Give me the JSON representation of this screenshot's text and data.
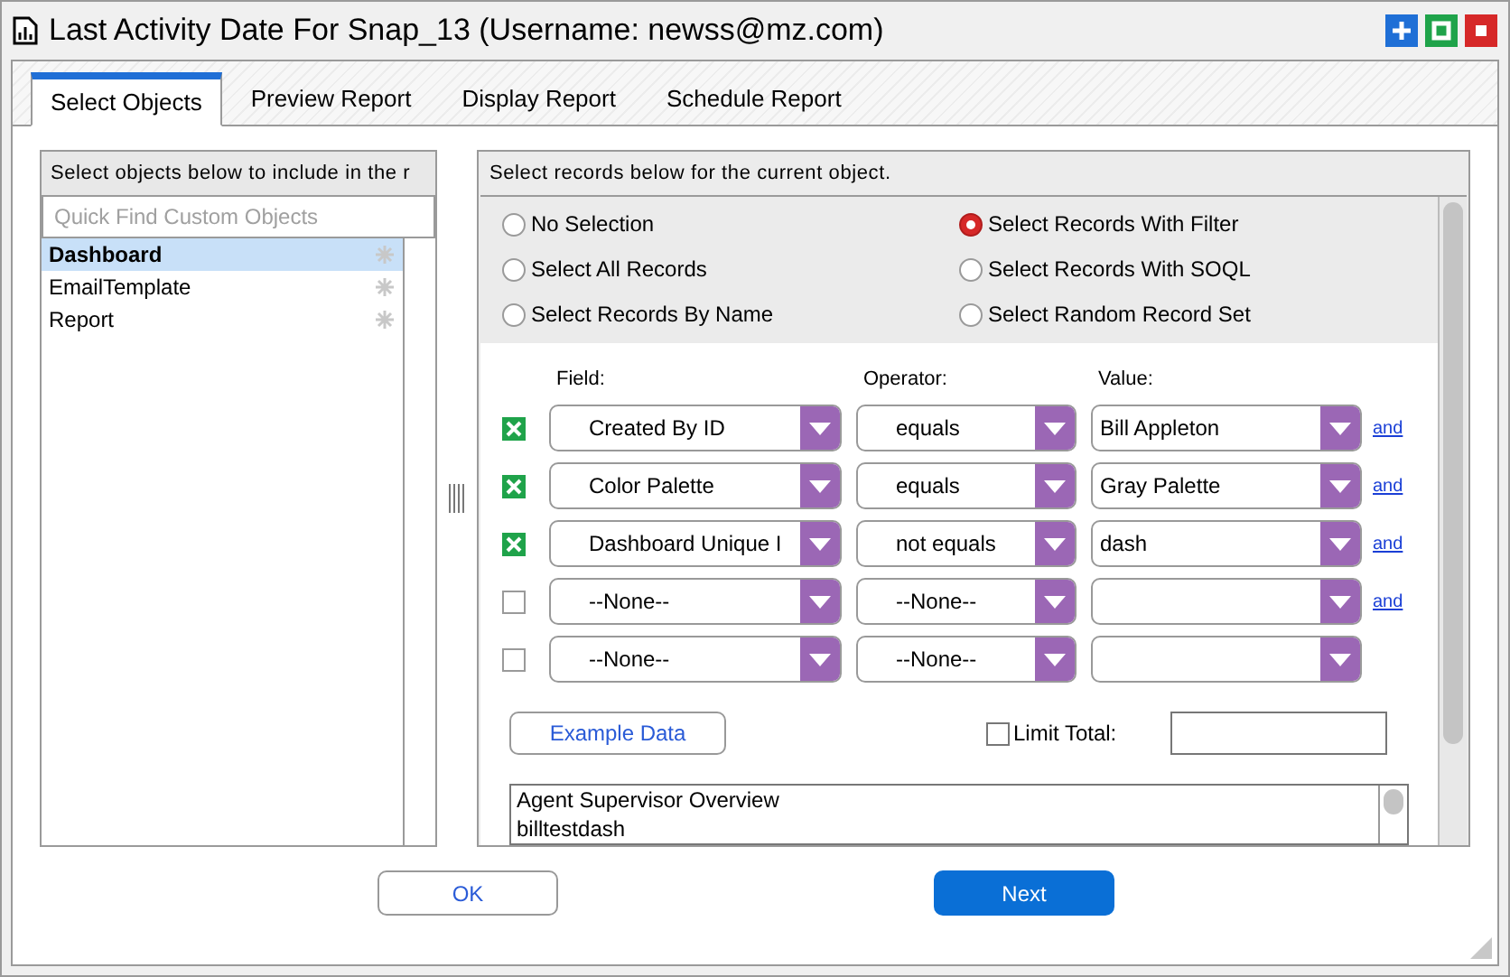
{
  "window": {
    "title": "Last Activity Date For Snap_13 (Username: newss@mz.com)"
  },
  "tabs": [
    {
      "label": "Select Objects",
      "selected": true
    },
    {
      "label": "Preview Report",
      "selected": false
    },
    {
      "label": "Display Report",
      "selected": false
    },
    {
      "label": "Schedule Report",
      "selected": false
    }
  ],
  "objects_panel": {
    "header": "Select objects below to include in the r",
    "search": {
      "placeholder": "Quick Find Custom Objects"
    },
    "items": [
      {
        "label": "Dashboard",
        "selected": true
      },
      {
        "label": "EmailTemplate",
        "selected": false
      },
      {
        "label": "Report",
        "selected": false
      }
    ]
  },
  "records_panel": {
    "header": "Select records below for the current object.",
    "options": [
      {
        "label": "No Selection",
        "selected": false
      },
      {
        "label": "Select Records With Filter",
        "selected": true
      },
      {
        "label": "Select All Records",
        "selected": false
      },
      {
        "label": "Select Records With SOQL",
        "selected": false
      },
      {
        "label": "Select Records By Name",
        "selected": false
      },
      {
        "label": "Select Random Record Set",
        "selected": false
      }
    ],
    "filter_headers": [
      "Field:",
      "Operator:",
      "Value:"
    ],
    "filters": [
      {
        "checked": true,
        "field": "Created By ID",
        "operator": "equals",
        "value": "Bill Appleton",
        "link": "and"
      },
      {
        "checked": true,
        "field": "Color Palette",
        "operator": "equals",
        "value": "Gray Palette",
        "link": "and"
      },
      {
        "checked": true,
        "field": "Dashboard Unique I",
        "operator": "not equals",
        "value": "dash",
        "link": "and"
      },
      {
        "checked": false,
        "field": "--None--",
        "operator": "--None--",
        "link": "and"
      },
      {
        "checked": false,
        "field": "--None--",
        "operator": "--None--"
      }
    ],
    "example_button": "Example Data",
    "limit_total": {
      "label": "Limit Total:",
      "checked": false
    },
    "results": [
      "Agent Supervisor Overview",
      "billtestdash"
    ]
  },
  "buttons": [
    "OK",
    "Next"
  ]
}
